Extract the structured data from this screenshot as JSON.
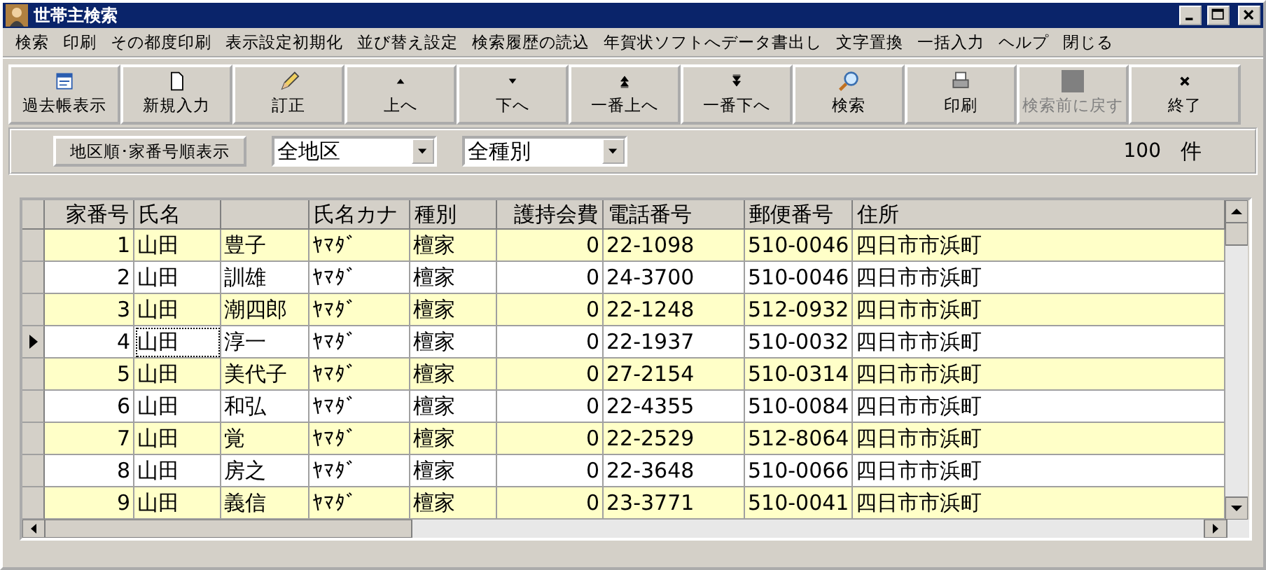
{
  "window": {
    "title": "世帯主検索"
  },
  "menu": [
    "検索",
    "印刷",
    "その都度印刷",
    "表示設定初期化",
    "並び替え設定",
    "検索履歴の読込",
    "年賀状ソフトへデータ書出し",
    "文字置換",
    "一括入力",
    "ヘルプ",
    "閉じる"
  ],
  "toolbar": [
    {
      "label": "過去帳表示",
      "disabled": false
    },
    {
      "label": "新規入力",
      "disabled": false
    },
    {
      "label": "訂正",
      "disabled": false
    },
    {
      "label": "上へ",
      "disabled": false
    },
    {
      "label": "下へ",
      "disabled": false
    },
    {
      "label": "一番上へ",
      "disabled": false
    },
    {
      "label": "一番下へ",
      "disabled": false
    },
    {
      "label": "検索",
      "disabled": false
    },
    {
      "label": "印刷",
      "disabled": false
    },
    {
      "label": "検索前に戻す",
      "disabled": true
    },
    {
      "label": "終了",
      "disabled": false
    }
  ],
  "filters": {
    "order_button": "地区順･家番号順表示",
    "district": "全地区",
    "type": "全種別",
    "count": "100",
    "count_unit": "件"
  },
  "table": {
    "columns": [
      "家番号",
      "氏名",
      "",
      "氏名カナ",
      "種別",
      "護持会費",
      "電話番号",
      "郵便番号",
      "住所"
    ],
    "rows": [
      {
        "selected": false,
        "cells": [
          "1",
          "山田",
          "豊子",
          "ﾔﾏﾀﾞ",
          "檀家",
          "0",
          "22-1098",
          "510-0046",
          "四日市市浜町"
        ]
      },
      {
        "selected": false,
        "cells": [
          "2",
          "山田",
          "訓雄",
          "ﾔﾏﾀﾞ",
          "檀家",
          "0",
          "24-3700",
          "510-0046",
          "四日市市浜町"
        ]
      },
      {
        "selected": false,
        "cells": [
          "3",
          "山田",
          "潮四郎",
          "ﾔﾏﾀﾞ",
          "檀家",
          "0",
          "22-1248",
          "512-0932",
          "四日市市浜町"
        ]
      },
      {
        "selected": true,
        "cells": [
          "4",
          "山田",
          "淳一",
          "ﾔﾏﾀﾞ",
          "檀家",
          "0",
          "22-1937",
          "510-0032",
          "四日市市浜町"
        ]
      },
      {
        "selected": false,
        "cells": [
          "5",
          "山田",
          "美代子",
          "ﾔﾏﾀﾞ",
          "檀家",
          "0",
          "27-2154",
          "510-0314",
          "四日市市浜町"
        ]
      },
      {
        "selected": false,
        "cells": [
          "6",
          "山田",
          "和弘",
          "ﾔﾏﾀﾞ",
          "檀家",
          "0",
          "22-4355",
          "510-0084",
          "四日市市浜町"
        ]
      },
      {
        "selected": false,
        "cells": [
          "7",
          "山田",
          "覚",
          "ﾔﾏﾀﾞ",
          "檀家",
          "0",
          "22-2529",
          "512-8064",
          "四日市市浜町"
        ]
      },
      {
        "selected": false,
        "cells": [
          "8",
          "山田",
          "房之",
          "ﾔﾏﾀﾞ",
          "檀家",
          "0",
          "22-3648",
          "510-0066",
          "四日市市浜町"
        ]
      },
      {
        "selected": false,
        "cells": [
          "9",
          "山田",
          "義信",
          "ﾔﾏﾀﾞ",
          "檀家",
          "0",
          "23-3771",
          "510-0041",
          "四日市市浜町"
        ]
      }
    ]
  }
}
